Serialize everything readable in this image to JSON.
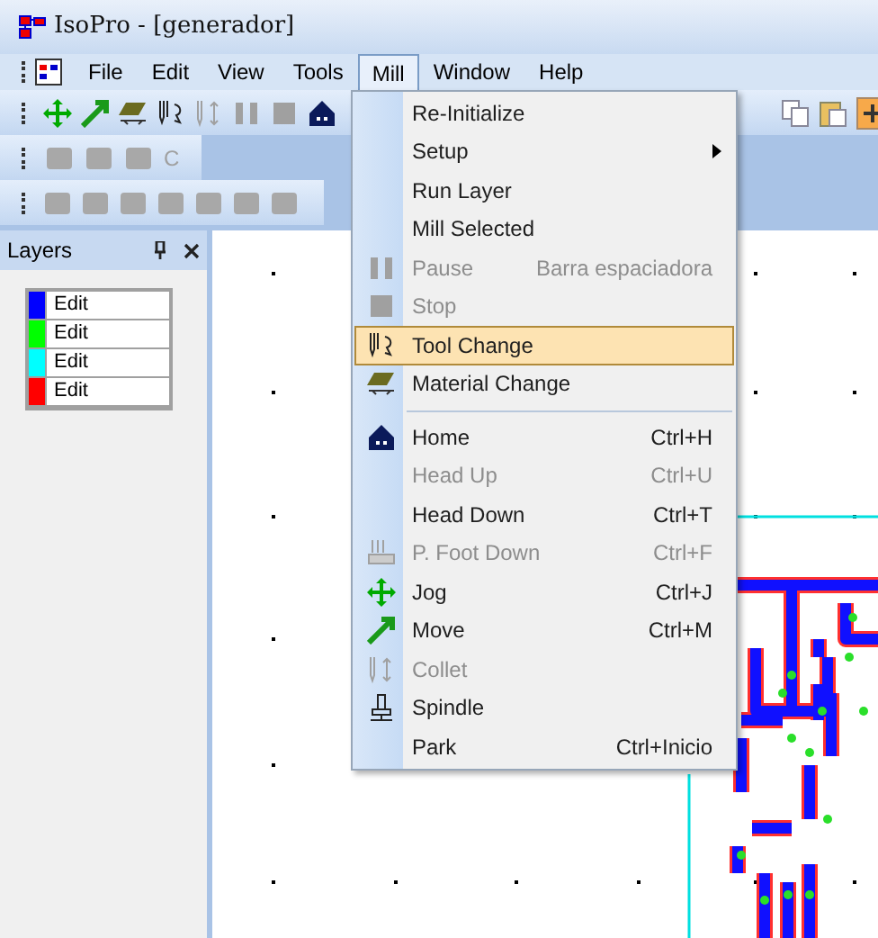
{
  "window": {
    "title": "IsoPro - [generador]"
  },
  "menu_bar": [
    {
      "label": "File",
      "selected": false
    },
    {
      "label": "Edit",
      "selected": false
    },
    {
      "label": "View",
      "selected": false
    },
    {
      "label": "Tools",
      "selected": false
    },
    {
      "label": "Mill",
      "selected": true
    },
    {
      "label": "Window",
      "selected": false
    },
    {
      "label": "Help",
      "selected": false
    }
  ],
  "toolbar_2": {
    "text_button": "C"
  },
  "layers_panel": {
    "title": "Layers",
    "layers": [
      {
        "label": "Edit",
        "color": "#0000ff"
      },
      {
        "label": "Edit",
        "color": "#00ff00"
      },
      {
        "label": "Edit",
        "color": "#00ffff"
      },
      {
        "label": "Edit",
        "color": "#ff0000"
      }
    ]
  },
  "mill_menu": {
    "items": [
      {
        "kind": "item",
        "label": "Re-Initialize",
        "disabled": false,
        "selected": false
      },
      {
        "kind": "submenu",
        "label": "Setup",
        "disabled": false,
        "selected": false
      },
      {
        "kind": "item",
        "label": "Run Layer",
        "disabled": false,
        "selected": false
      },
      {
        "kind": "item",
        "label": "Mill Selected",
        "disabled": false,
        "selected": false
      },
      {
        "kind": "item",
        "label": "Pause",
        "shortcut": "Barra espaciadora",
        "disabled": true,
        "selected": false
      },
      {
        "kind": "item",
        "label": "Stop",
        "disabled": true,
        "selected": false
      },
      {
        "kind": "item",
        "label": "Tool Change",
        "disabled": false,
        "selected": true
      },
      {
        "kind": "item",
        "label": "Material Change",
        "disabled": false,
        "selected": false
      },
      {
        "kind": "separator"
      },
      {
        "kind": "item",
        "label": "Home",
        "shortcut": "Ctrl+H",
        "disabled": false,
        "selected": false
      },
      {
        "kind": "item",
        "label": "Head Up",
        "shortcut": "Ctrl+U",
        "disabled": true,
        "selected": false
      },
      {
        "kind": "item",
        "label": "Head Down",
        "shortcut": "Ctrl+T",
        "disabled": false,
        "selected": false
      },
      {
        "kind": "item",
        "label": "P. Foot Down",
        "shortcut": "Ctrl+F",
        "disabled": true,
        "selected": false
      },
      {
        "kind": "item",
        "label": "Jog",
        "shortcut": "Ctrl+J",
        "disabled": false,
        "selected": false
      },
      {
        "kind": "item",
        "label": "Move",
        "shortcut": "Ctrl+M",
        "disabled": false,
        "selected": false
      },
      {
        "kind": "item",
        "label": "Collet",
        "disabled": true,
        "selected": false
      },
      {
        "kind": "item",
        "label": "Spindle",
        "disabled": false,
        "selected": false
      },
      {
        "kind": "item",
        "label": "Park",
        "shortcut": "Ctrl+Inicio",
        "disabled": false,
        "selected": false
      }
    ]
  }
}
